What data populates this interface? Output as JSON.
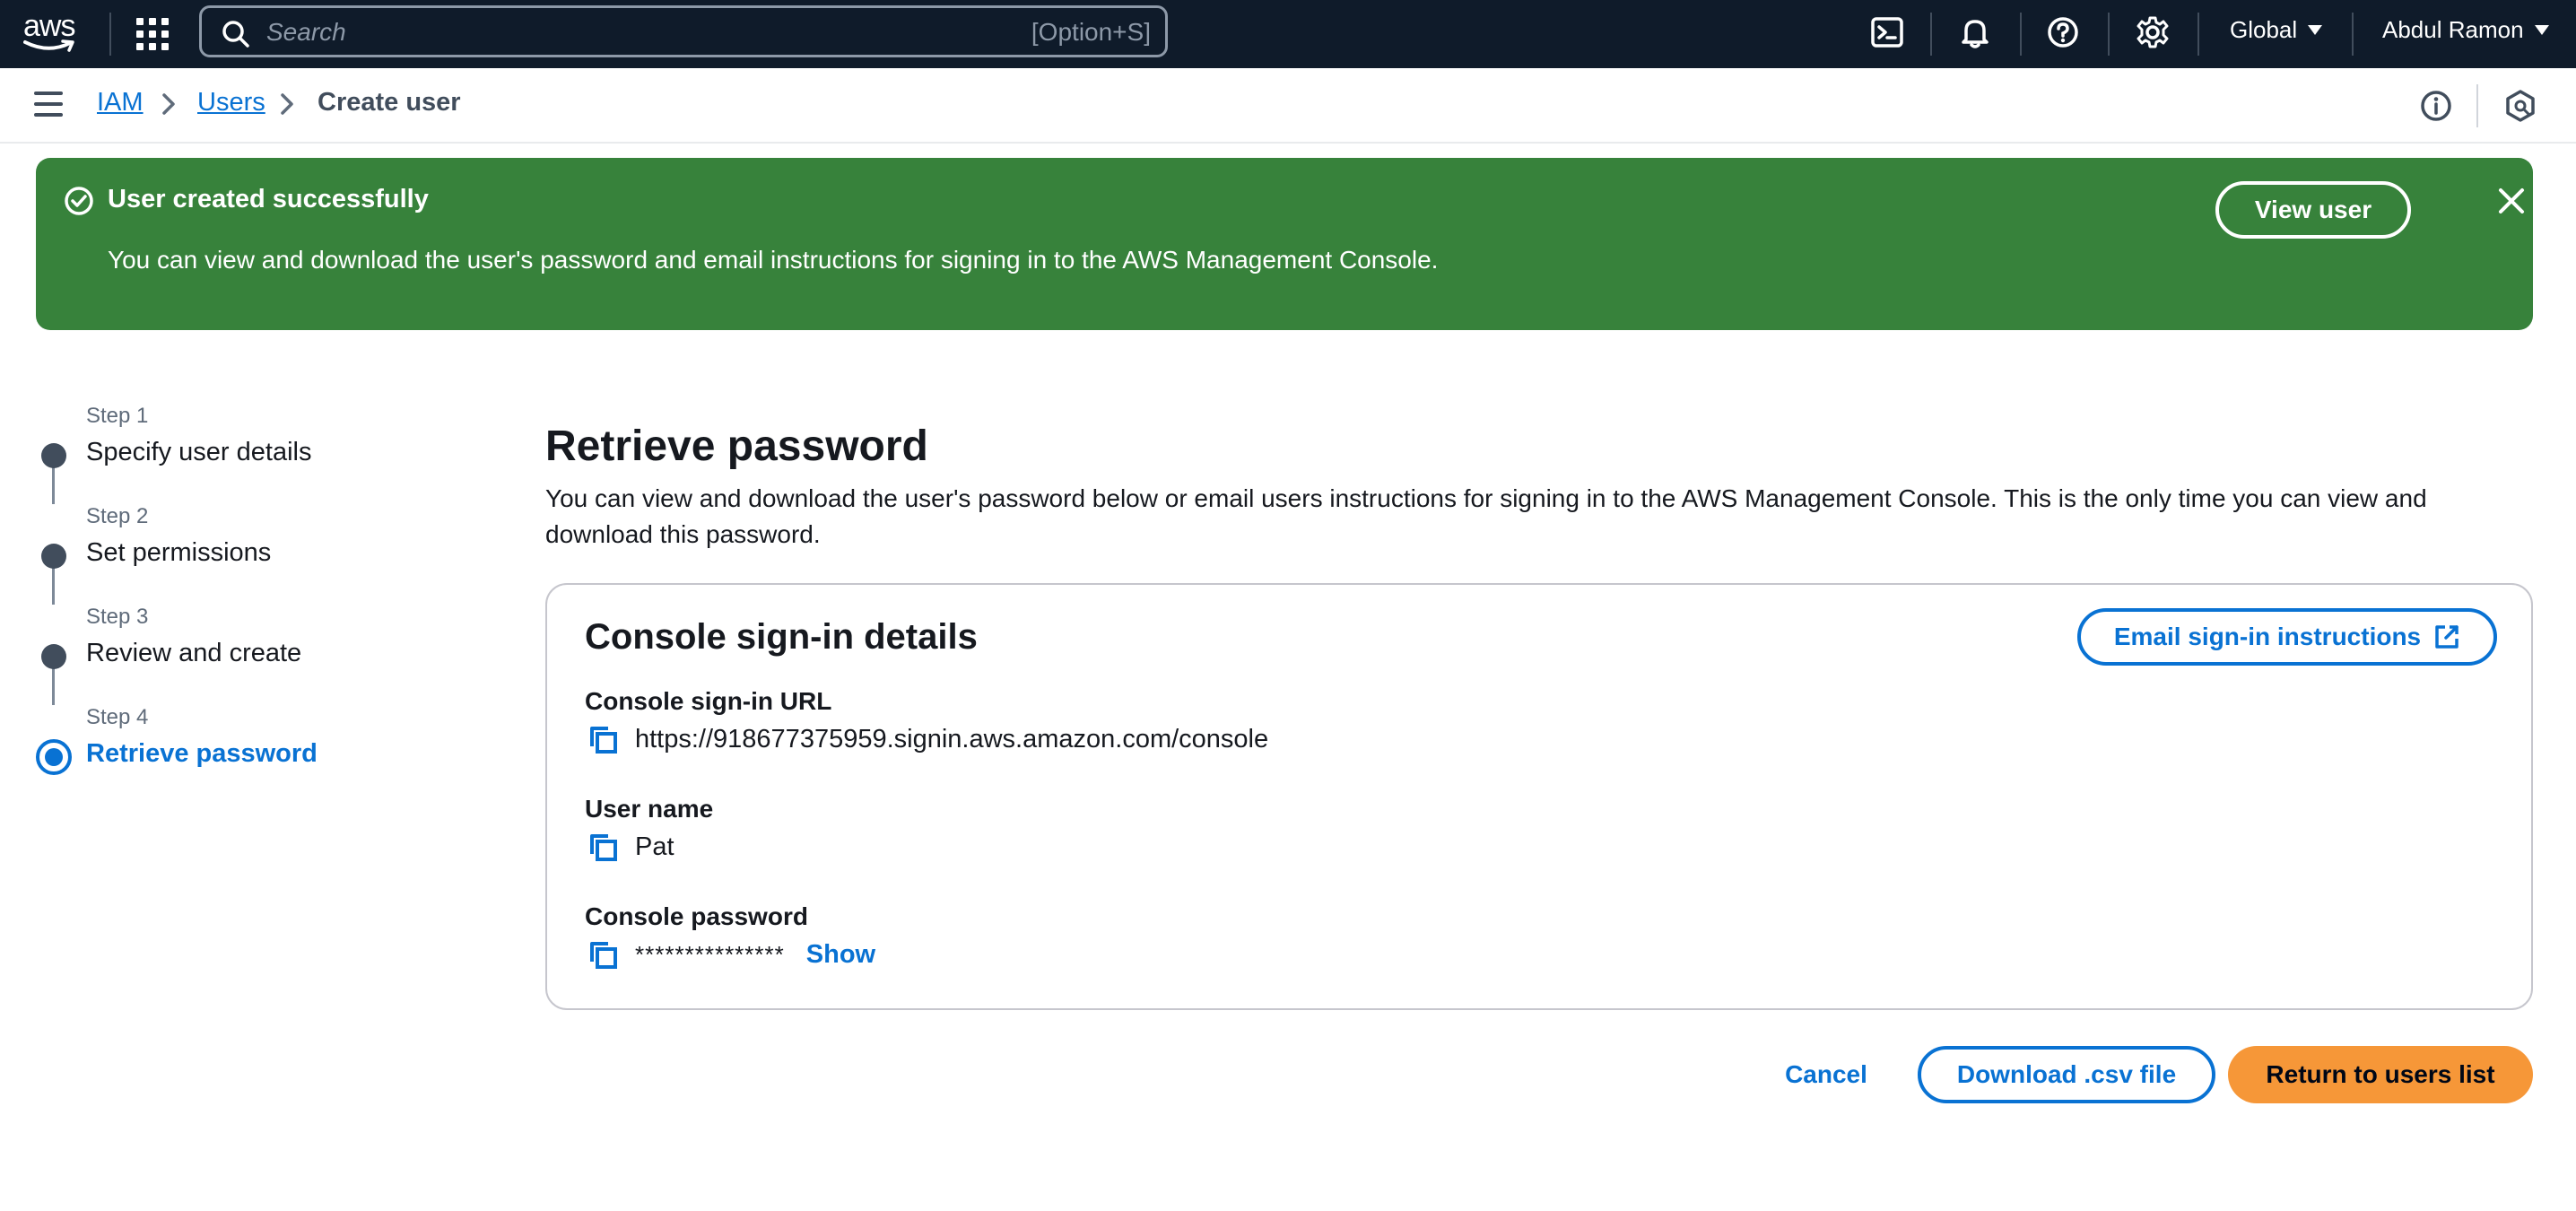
{
  "topnav": {
    "logo_text": "aws",
    "search_placeholder": "Search",
    "search_shortcut": "[Option+S]",
    "region": "Global",
    "account": "Abdul Ramon",
    "icons": [
      "cloudshell-icon",
      "bell-icon",
      "help-icon",
      "gear-icon"
    ]
  },
  "breadcrumb": {
    "items": [
      "IAM",
      "Users"
    ],
    "current": "Create user"
  },
  "flash": {
    "title": "User created successfully",
    "message": "You can view and download the user's password and email instructions for signing in to the AWS Management Console.",
    "action_label": "View user",
    "color": "#37823b"
  },
  "steps": [
    {
      "number": "Step 1",
      "label": "Specify user details"
    },
    {
      "number": "Step 2",
      "label": "Set permissions"
    },
    {
      "number": "Step 3",
      "label": "Review and create"
    },
    {
      "number": "Step 4",
      "label": "Retrieve password"
    }
  ],
  "main": {
    "title": "Retrieve password",
    "description": "You can view and download the user's password below or email users instructions for signing in to the AWS Management Console. This is the only time you can view and download this password."
  },
  "card": {
    "title": "Console sign-in details",
    "email_button": "Email sign-in instructions",
    "fields": {
      "url_label": "Console sign-in URL",
      "url_value": "https://918677375959.signin.aws.amazon.com/console",
      "username_label": "User name",
      "username_value": "Pat",
      "password_label": "Console password",
      "password_value": "***************",
      "show_label": "Show"
    }
  },
  "footer": {
    "cancel": "Cancel",
    "download": "Download .csv file",
    "primary": "Return to users list"
  },
  "colors": {
    "nav_bg": "#0f1b2a",
    "link": "#0972d3",
    "primary_button": "#f69738",
    "success": "#37823b"
  }
}
